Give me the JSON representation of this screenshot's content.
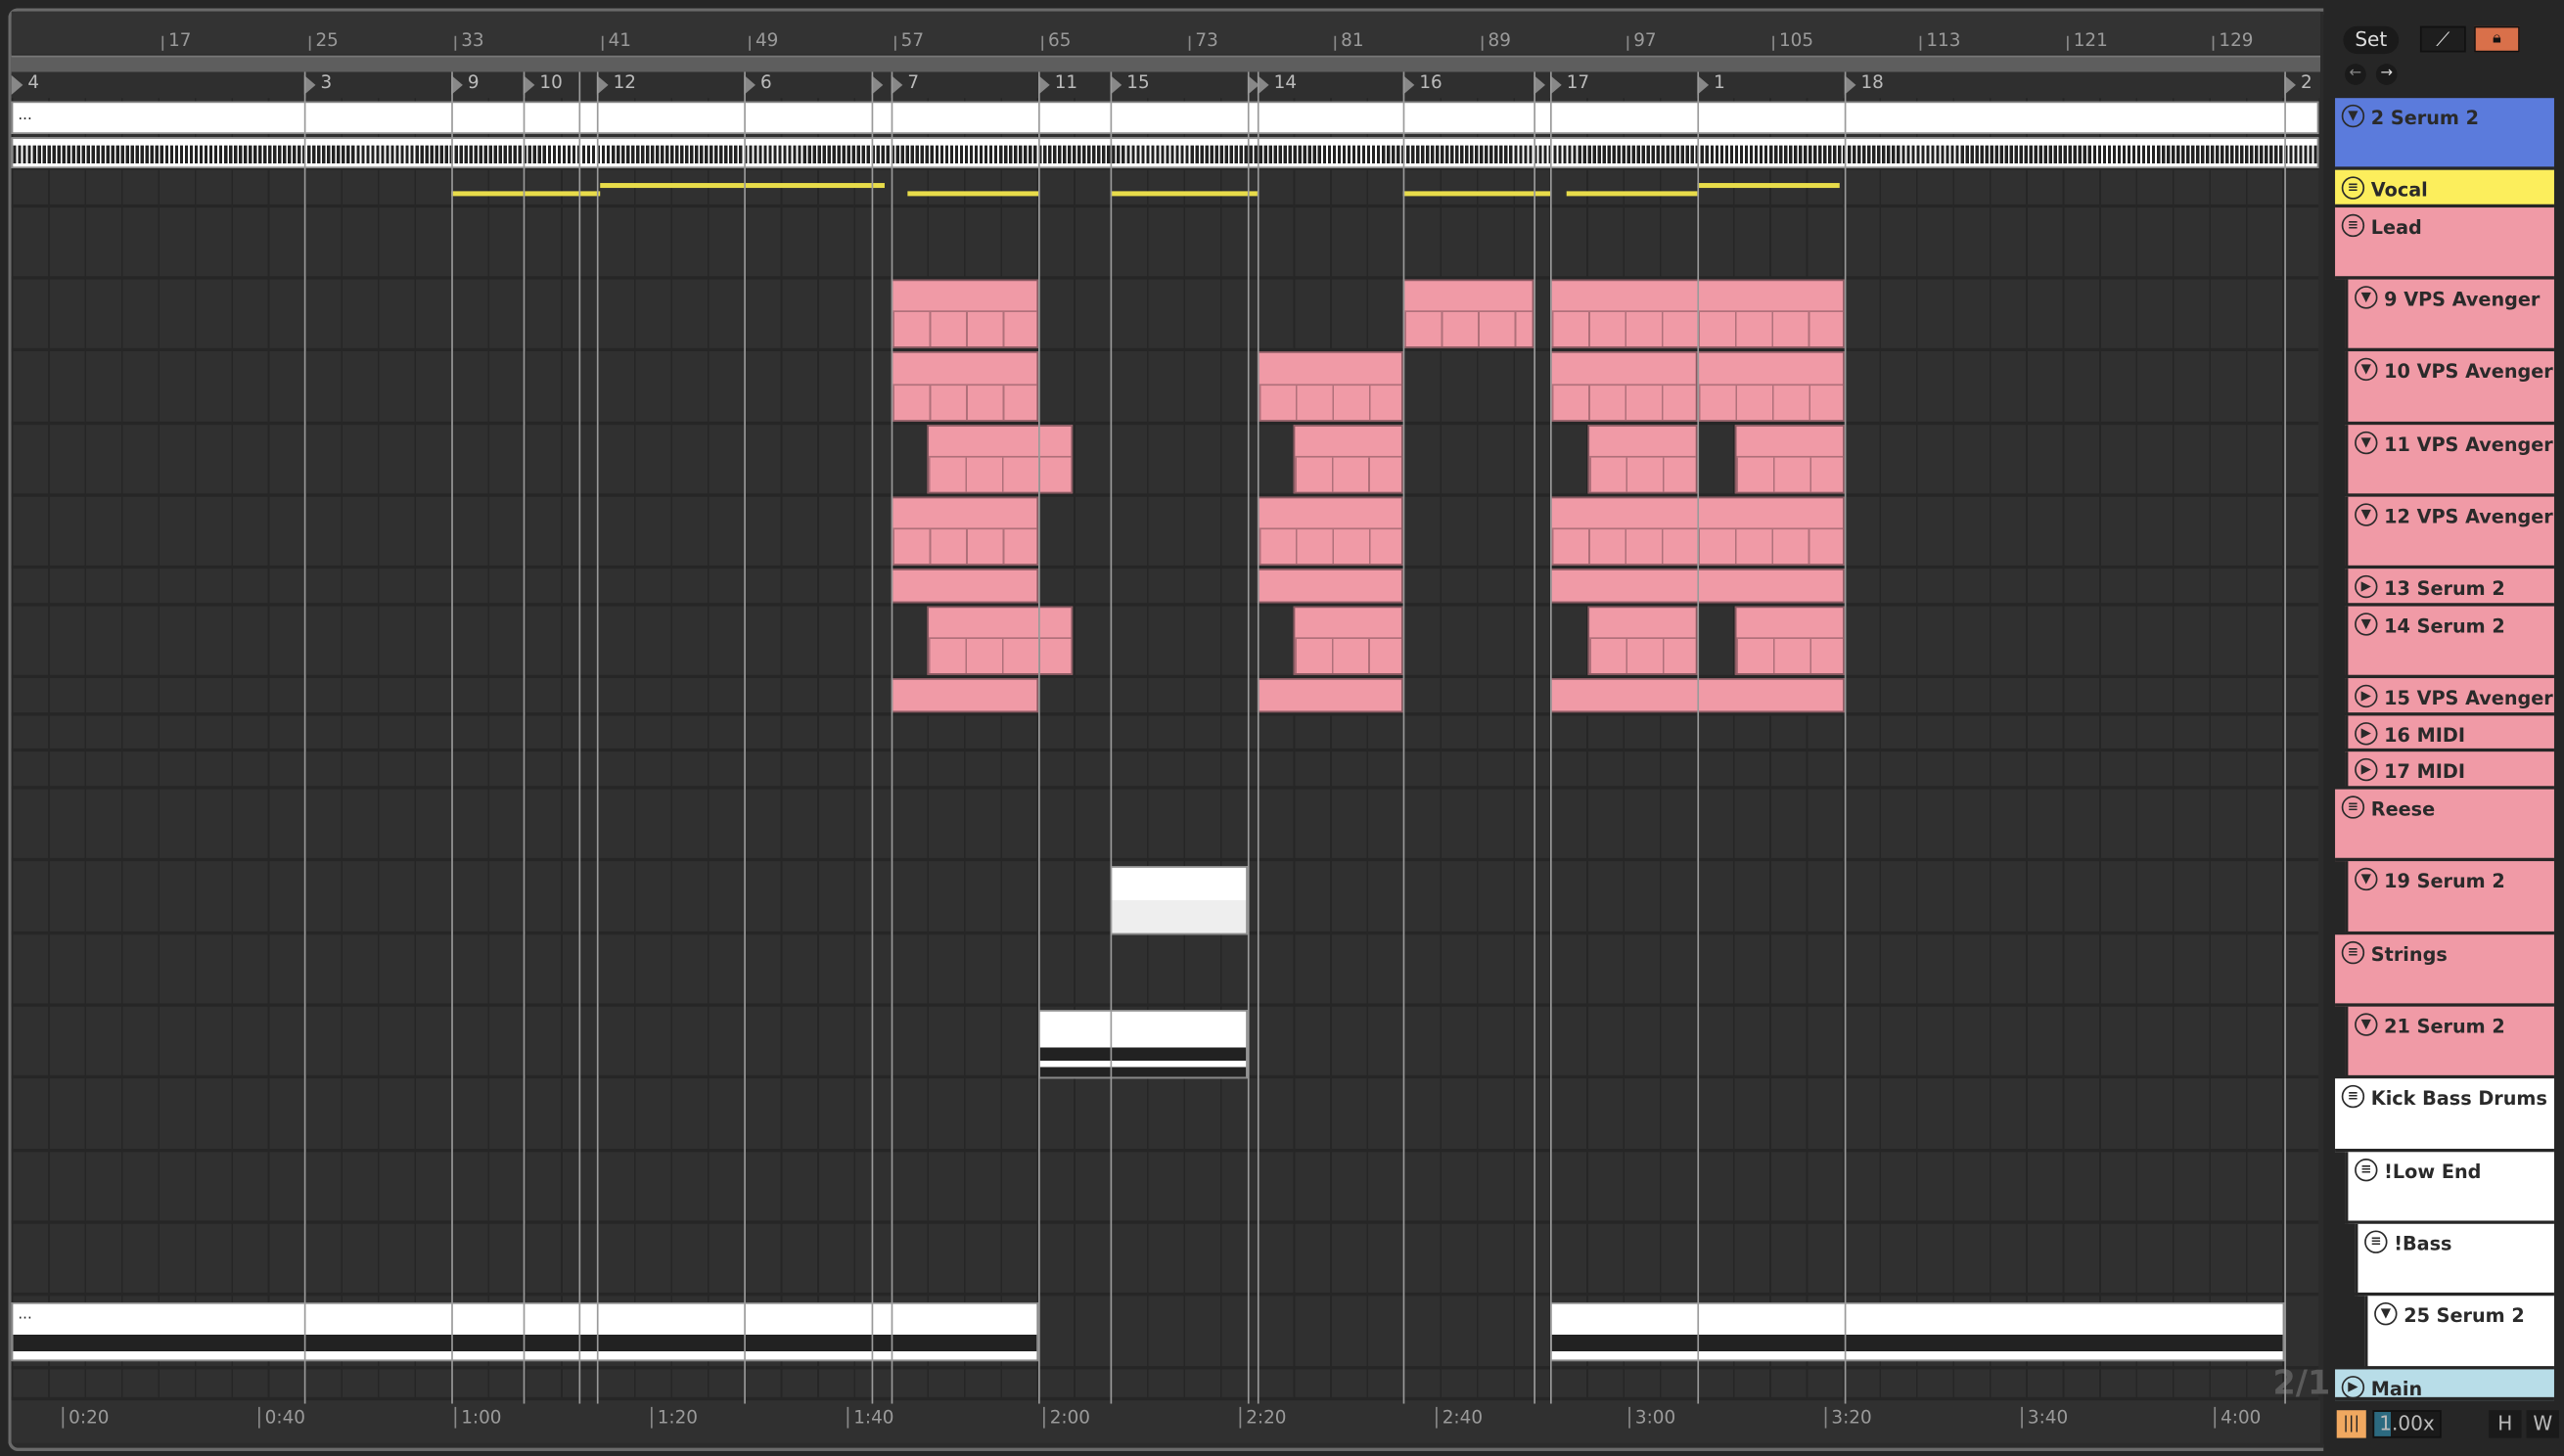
{
  "bar_ruler": [
    "17",
    "25",
    "33",
    "41",
    "49",
    "57",
    "65",
    "73",
    "81",
    "89",
    "97",
    "105",
    "113",
    "121",
    "129"
  ],
  "locators": [
    "4",
    "3",
    "9",
    "10",
    "12",
    "6",
    "7",
    "11",
    "15",
    "14",
    "16",
    "17",
    "1",
    "18",
    "2"
  ],
  "time_ruler": [
    "0:20",
    "0:40",
    "1:00",
    "1:20",
    "1:40",
    "2:00",
    "2:20",
    "2:40",
    "3:00",
    "3:20",
    "3:40",
    "4:00"
  ],
  "clip_ellipsis": "...",
  "grid_label": "2/1",
  "header": {
    "set": "Set",
    "nav_back": "back-arrow-icon",
    "nav_forward": "forward-arrow-icon",
    "lock_color": "#d9704a"
  },
  "tracks": [
    {
      "name": "2 Serum 2",
      "icon": "▼",
      "color": "#5b7bdc"
    },
    {
      "name": "Vocal",
      "icon": "≡",
      "color": "#fcee5c"
    },
    {
      "name": "Lead",
      "icon": "≡",
      "color": "#f09aa6"
    },
    {
      "name": "9 VPS Avenger",
      "icon": "▼",
      "color": "#f09aa6"
    },
    {
      "name": "10 VPS Avenger",
      "icon": "▼",
      "color": "#f09aa6"
    },
    {
      "name": "11 VPS Avenger",
      "icon": "▼",
      "color": "#f09aa6"
    },
    {
      "name": "12 VPS Avenger",
      "icon": "▼",
      "color": "#f09aa6"
    },
    {
      "name": "13 Serum 2",
      "icon": "▶",
      "color": "#f09aa6"
    },
    {
      "name": "14 Serum 2",
      "icon": "▼",
      "color": "#f09aa6"
    },
    {
      "name": "15 VPS Avenger",
      "icon": "▶",
      "color": "#f09aa6"
    },
    {
      "name": "16 MIDI",
      "icon": "▶",
      "color": "#f09aa6"
    },
    {
      "name": "17 MIDI",
      "icon": "▶",
      "color": "#f09aa6"
    },
    {
      "name": "Reese",
      "icon": "≡",
      "color": "#f09aa6"
    },
    {
      "name": "19 Serum 2",
      "icon": "▼",
      "color": "#f09aa6"
    },
    {
      "name": "Strings",
      "icon": "≡",
      "color": "#f09aa6"
    },
    {
      "name": "21 Serum 2",
      "icon": "▼",
      "color": "#f09aa6"
    },
    {
      "name": "Kick Bass Drums",
      "icon": "≡",
      "color": "#ffffff"
    },
    {
      "name": "!Low End",
      "icon": "≡",
      "color": "#ffffff"
    },
    {
      "name": "!Bass",
      "icon": "≡",
      "color": "#ffffff"
    },
    {
      "name": "25 Serum 2",
      "icon": "▼",
      "color": "#ffffff"
    },
    {
      "name": "Main",
      "icon": "▶",
      "color": "#b8dde8"
    }
  ],
  "footer": {
    "zoom": "1.00x",
    "h": "H",
    "w": "W"
  }
}
